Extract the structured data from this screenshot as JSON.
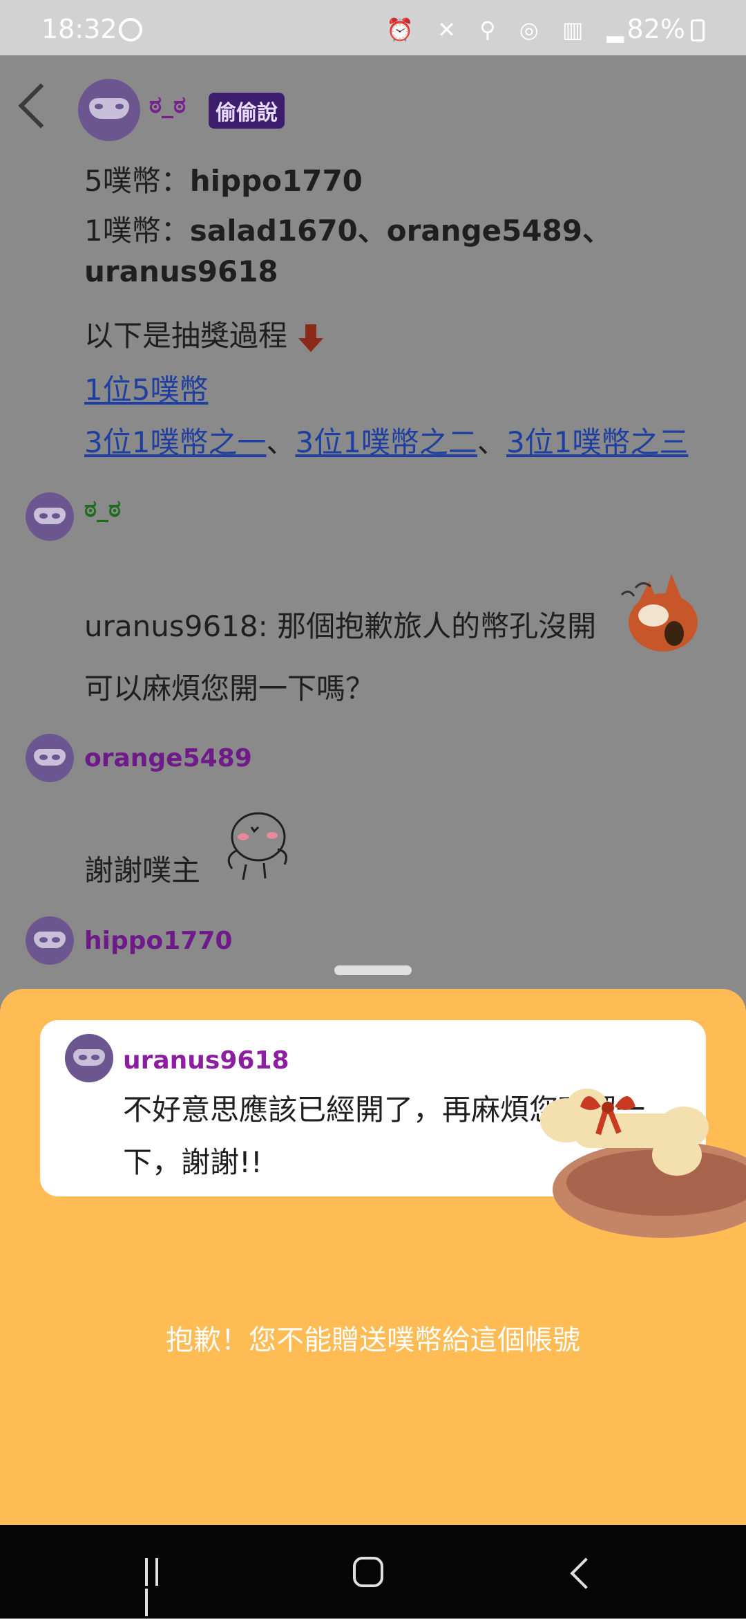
{
  "status_bar": {
    "time": "18:32",
    "battery": "82%"
  },
  "header": {
    "name": "ಠ_ಠ",
    "badge": "偷偷說"
  },
  "op_post": {
    "line1_prefix": "5噗幣：",
    "line1_user": "hippo1770",
    "line2_prefix": "1噗幣：",
    "line2_users": "salad1670、orange5489、",
    "line3_user": "uranus9618",
    "line4": "以下是抽獎過程",
    "link1": "1位5噗幣",
    "link2": "3位1噗幣之一",
    "link3": "3位1噗幣之二",
    "link4": "3位1噗幣之三",
    "separator": "、"
  },
  "replies": [
    {
      "name": "ಠ_ಠ",
      "text1": "uranus9618: 那個抱歉旅人的幣孔沒開",
      "text2": "可以麻煩您開一下嗎？"
    },
    {
      "name": "orange5489",
      "text1": "謝謝噗主"
    },
    {
      "name": "hippo1770"
    }
  ],
  "sheet": {
    "card_name": "uranus9618",
    "card_message": "不好意思應該已經開了，再麻煩您確認一下，謝謝!!",
    "warning": "抱歉！您不能贈送噗幣給這個帳號"
  },
  "colors": {
    "op_name": "#7a1d8f",
    "green_name": "#1e6b1e",
    "reply_name": "#6e1a88",
    "sheet_bg": "#ffbb54",
    "link": "#1e3fa0"
  },
  "icons": [
    "back-icon",
    "mask-avatar-icon",
    "down-arrow-icon",
    "nav-recent-icon",
    "nav-home-icon",
    "nav-back-icon"
  ]
}
